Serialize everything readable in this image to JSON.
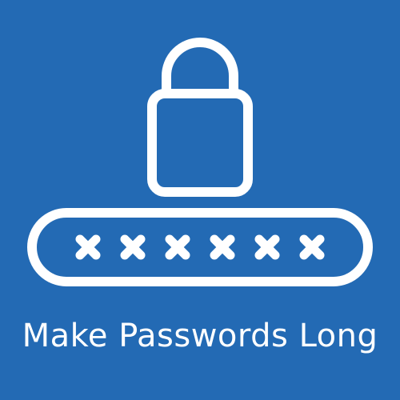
{
  "colors": {
    "background": "#236ab4",
    "foreground": "#ffffff"
  },
  "icons": {
    "lock": "padlock-icon",
    "password_field": "password-field-icon",
    "mask_char": "x-mark-icon"
  },
  "password_field": {
    "masked_char_count": 6
  },
  "caption": "Make Passwords Long"
}
